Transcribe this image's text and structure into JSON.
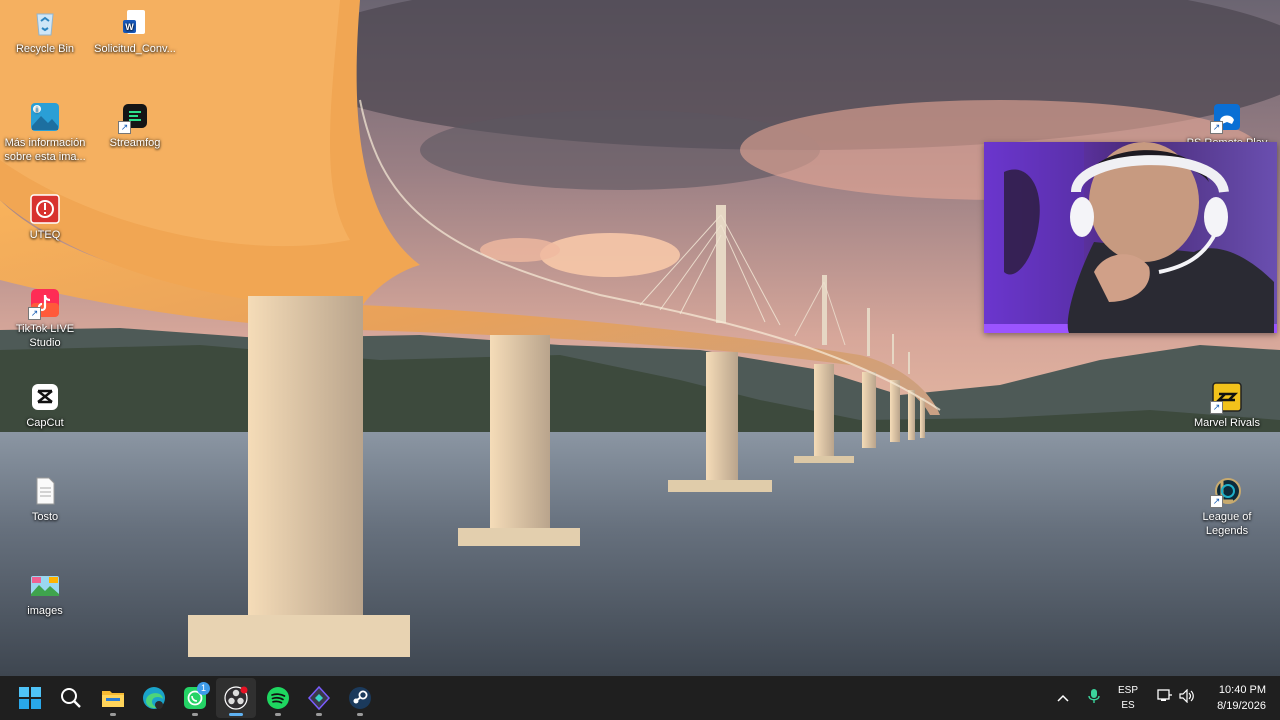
{
  "desktop": {
    "left_icons": [
      {
        "label": "Recycle Bin",
        "icon": "recycle-bin-icon"
      },
      {
        "label": "Solicitud_Conv...",
        "icon": "word-document-icon"
      },
      {
        "label": "Más información sobre esta ima...",
        "icon": "spotlight-info-icon"
      },
      {
        "label": "Streamfog",
        "icon": "streamfog-icon"
      },
      {
        "label": "UTEQ",
        "icon": "uteq-icon"
      },
      {
        "label": "TikTok LIVE Studio",
        "icon": "tiktok-live-studio-icon"
      },
      {
        "label": "CapCut",
        "icon": "capcut-icon"
      },
      {
        "label": "Tosto",
        "icon": "text-file-icon"
      },
      {
        "label": "images",
        "icon": "images-icon"
      }
    ],
    "right_icons": [
      {
        "label": "PS Remote Play",
        "icon": "ps-remote-play-icon"
      },
      {
        "label": "Marvel Rivals",
        "icon": "marvel-rivals-icon"
      },
      {
        "label": "League of Legends",
        "icon": "league-of-legends-icon"
      }
    ]
  },
  "webcam": {
    "description": "webcam overlay"
  },
  "taskbar": {
    "apps": [
      {
        "name": "Start",
        "icon": "windows-start-icon"
      },
      {
        "name": "Search",
        "icon": "search-icon"
      },
      {
        "name": "File Explorer",
        "icon": "folder-icon"
      },
      {
        "name": "Microsoft Edge",
        "icon": "edge-icon"
      },
      {
        "name": "WhatsApp",
        "icon": "whatsapp-icon",
        "badge": "1"
      },
      {
        "name": "OBS Studio",
        "icon": "obs-icon"
      },
      {
        "name": "Spotify",
        "icon": "spotify-icon"
      },
      {
        "name": "App",
        "icon": "diamond-app-icon"
      },
      {
        "name": "Steam",
        "icon": "steam-icon"
      }
    ],
    "language": {
      "top": "ESP",
      "bottom": "ES"
    },
    "time": "10:40 PM",
    "date": "8/19/2026"
  },
  "colors": {
    "taskbar": "#1f1f1f",
    "accent": "#5fb2f2",
    "webcam_purple": "#8a3cff"
  }
}
